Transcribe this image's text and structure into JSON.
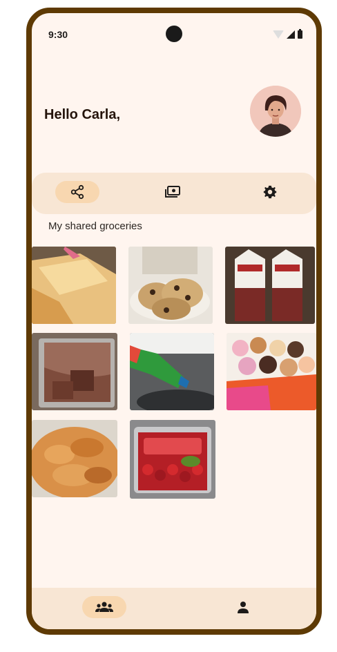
{
  "status_bar": {
    "time": "9:30"
  },
  "header": {
    "greeting": "Hello Carla,"
  },
  "toolbar": {
    "items": [
      {
        "icon": "share-icon",
        "active": true
      },
      {
        "icon": "money-icon",
        "active": false
      },
      {
        "icon": "gear-icon",
        "active": false
      }
    ]
  },
  "section": {
    "title": "My shared groceries"
  },
  "groceries": [
    {
      "name": "cornbread-photo"
    },
    {
      "name": "cookies-photo"
    },
    {
      "name": "milk-cartons-photo"
    },
    {
      "name": "brownies-photo"
    },
    {
      "name": "dish-soap-photo"
    },
    {
      "name": "donuts-box-photo"
    },
    {
      "name": "chips-photo"
    },
    {
      "name": "strawberries-photo"
    }
  ],
  "bottom_nav": {
    "items": [
      {
        "icon": "group-icon",
        "active": true
      },
      {
        "icon": "person-icon",
        "active": false
      }
    ]
  },
  "colors": {
    "frame": "#5e3a04",
    "background": "#fff5ef",
    "bar": "#f8e6d4",
    "active_pill": "#f8d7b0"
  }
}
